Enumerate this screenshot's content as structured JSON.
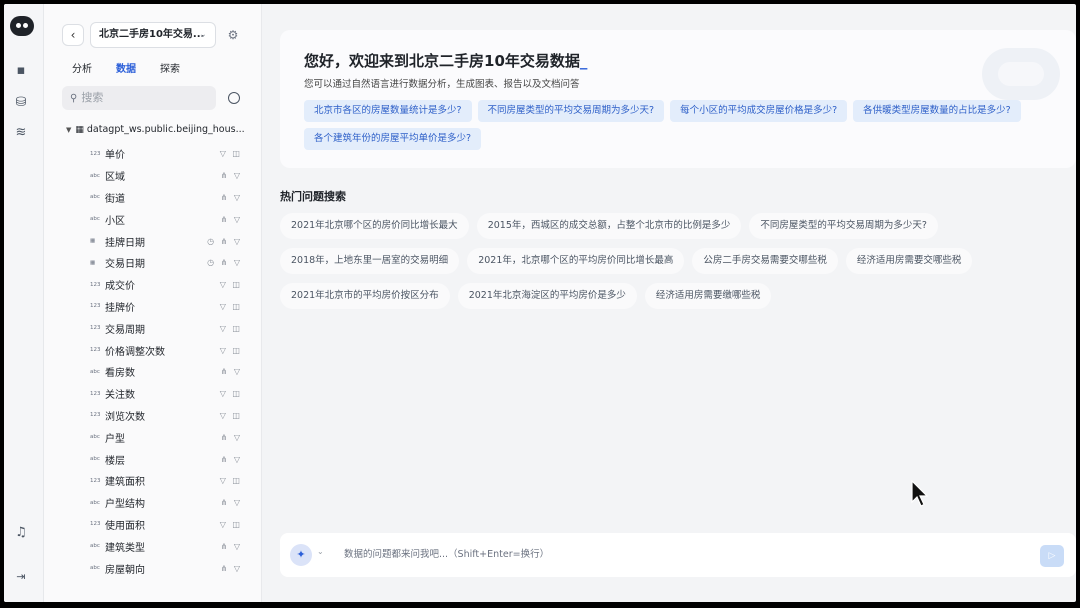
{
  "sidebar": {
    "datasource_name": "北京二手房10年交易...",
    "tabs": [
      "分析",
      "数据",
      "探索"
    ],
    "active_tab": "数据",
    "search_placeholder": "搜索",
    "tree_root_label": "datagpt_ws.public.beijing_hous...",
    "fields": [
      {
        "label": "单价",
        "type": "123",
        "actions": "▽ ◫"
      },
      {
        "label": "区域",
        "type": "abc",
        "actions": "⋔ ▽"
      },
      {
        "label": "街道",
        "type": "abc",
        "actions": "⋔ ▽"
      },
      {
        "label": "小区",
        "type": "abc",
        "actions": "⋔ ▽"
      },
      {
        "label": "挂牌日期",
        "type": "▦",
        "actions": "◷ ⋔ ▽"
      },
      {
        "label": "交易日期",
        "type": "▦",
        "actions": "◷ ⋔ ▽"
      },
      {
        "label": "成交价",
        "type": "123",
        "actions": "▽ ◫"
      },
      {
        "label": "挂牌价",
        "type": "123",
        "actions": "▽ ◫"
      },
      {
        "label": "交易周期",
        "type": "123",
        "actions": "▽ ◫"
      },
      {
        "label": "价格调整次数",
        "type": "123",
        "actions": "▽ ◫"
      },
      {
        "label": "看房数",
        "type": "abc",
        "actions": "⋔ ▽"
      },
      {
        "label": "关注数",
        "type": "123",
        "actions": "▽ ◫"
      },
      {
        "label": "浏览次数",
        "type": "123",
        "actions": "▽ ◫"
      },
      {
        "label": "户型",
        "type": "abc",
        "actions": "⋔ ▽"
      },
      {
        "label": "楼层",
        "type": "abc",
        "actions": "⋔ ▽"
      },
      {
        "label": "建筑面积",
        "type": "123",
        "actions": "▽ ◫"
      },
      {
        "label": "户型结构",
        "type": "abc",
        "actions": "⋔ ▽"
      },
      {
        "label": "使用面积",
        "type": "123",
        "actions": "▽ ◫"
      },
      {
        "label": "建筑类型",
        "type": "abc",
        "actions": "⋔ ▽"
      },
      {
        "label": "房屋朝向",
        "type": "abc",
        "actions": "⋔ ▽"
      }
    ]
  },
  "welcome": {
    "title": "您好，欢迎来到北京二手房10年交易数据",
    "cursor": "_",
    "subtitle": "您可以通过自然语言进行数据分析，生成图表、报告以及文档问答",
    "suggestions": [
      "北京市各区的房屋数量统计是多少?",
      "不同房屋类型的平均交易周期为多少天?",
      "每个小区的平均成交房屋价格是多少?",
      "各供暖类型房屋数量的占比是多少?",
      "各个建筑年份的房屋平均单价是多少?"
    ]
  },
  "hot": {
    "title": "热门问题搜索",
    "items": [
      "2021年北京哪个区的房价同比增长最大",
      "2015年，西城区的成交总额，占整个北京市的比例是多少",
      "不同房屋类型的平均交易周期为多少天?",
      "2018年，上地东里一居室的交易明细",
      "2021年，北京哪个区的平均房价同比增长最高",
      "公房二手房交易需要交哪些税",
      "经济适用房需要交哪些税",
      "2021年北京市的平均房价按区分布",
      "2021年北京海淀区的平均房价是多少",
      "经济适用房需要缴哪些税"
    ]
  },
  "composer": {
    "placeholder": "数据的问题都来问我吧...（Shift+Enter=换行）"
  },
  "icons": {
    "rail": [
      "logo-icon",
      "chat-icon",
      "database-icon",
      "layers-icon",
      "bell-icon",
      "expand-icon"
    ],
    "accent": "#2b5fd9",
    "suggestion_bg": "#e3edfb"
  }
}
